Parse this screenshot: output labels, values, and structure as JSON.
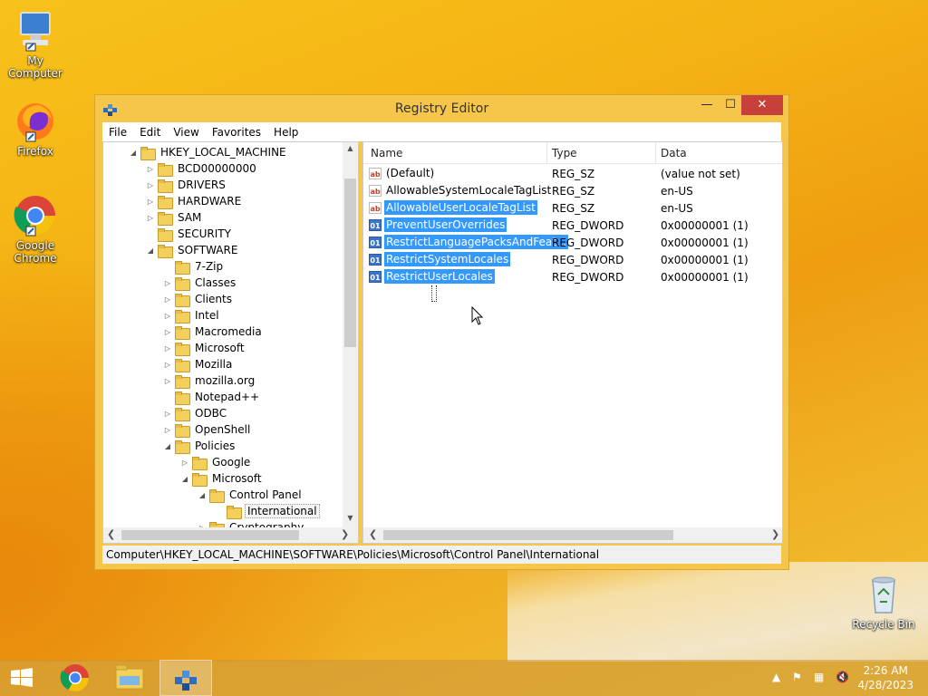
{
  "desktop": {
    "icons": [
      {
        "label": "My Computer"
      },
      {
        "label": "Firefox"
      },
      {
        "label": "Google Chrome"
      },
      {
        "label": "Recycle Bin"
      }
    ]
  },
  "window": {
    "title": "Registry Editor",
    "controls": {
      "minimize": "—",
      "maximize": "☐",
      "close": "✕"
    },
    "menu": [
      "File",
      "Edit",
      "View",
      "Favorites",
      "Help"
    ]
  },
  "tree": [
    {
      "label": "HKEY_LOCAL_MACHINE",
      "level": 0,
      "expander": "◢"
    },
    {
      "label": "BCD00000000",
      "level": 1,
      "expander": "▷"
    },
    {
      "label": "DRIVERS",
      "level": 1,
      "expander": "▷"
    },
    {
      "label": "HARDWARE",
      "level": 1,
      "expander": "▷"
    },
    {
      "label": "SAM",
      "level": 1,
      "expander": "▷"
    },
    {
      "label": "SECURITY",
      "level": 1,
      "expander": ""
    },
    {
      "label": "SOFTWARE",
      "level": 1,
      "expander": "◢"
    },
    {
      "label": "7-Zip",
      "level": 2,
      "expander": ""
    },
    {
      "label": "Classes",
      "level": 2,
      "expander": "▷"
    },
    {
      "label": "Clients",
      "level": 2,
      "expander": "▷"
    },
    {
      "label": "Intel",
      "level": 2,
      "expander": "▷"
    },
    {
      "label": "Macromedia",
      "level": 2,
      "expander": "▷"
    },
    {
      "label": "Microsoft",
      "level": 2,
      "expander": "▷"
    },
    {
      "label": "Mozilla",
      "level": 2,
      "expander": "▷"
    },
    {
      "label": "mozilla.org",
      "level": 2,
      "expander": "▷"
    },
    {
      "label": "Notepad++",
      "level": 2,
      "expander": ""
    },
    {
      "label": "ODBC",
      "level": 2,
      "expander": "▷"
    },
    {
      "label": "OpenShell",
      "level": 2,
      "expander": "▷"
    },
    {
      "label": "Policies",
      "level": 2,
      "expander": "◢"
    },
    {
      "label": "Google",
      "level": 3,
      "expander": "▷"
    },
    {
      "label": "Microsoft",
      "level": 3,
      "expander": "◢"
    },
    {
      "label": "Control Panel",
      "level": 4,
      "expander": "◢"
    },
    {
      "label": "International",
      "level": 5,
      "expander": "",
      "selected": true
    },
    {
      "label": "Cryptography",
      "level": 4,
      "expander": "▷"
    }
  ],
  "list": {
    "columns": {
      "name": "Name",
      "type": "Type",
      "data": "Data"
    },
    "rows": [
      {
        "icon": "ab",
        "name": "(Default)",
        "type": "REG_SZ",
        "data": "(value not set)",
        "highlight": false
      },
      {
        "icon": "ab",
        "name": "AllowableSystemLocaleTagList",
        "type": "REG_SZ",
        "data": "en-US",
        "highlight": false
      },
      {
        "icon": "ab",
        "name": "AllowableUserLocaleTagList",
        "type": "REG_SZ",
        "data": "en-US",
        "highlight": true
      },
      {
        "icon": "01",
        "name": "PreventUserOverrides",
        "type": "REG_DWORD",
        "data": "0x00000001 (1)",
        "highlight": true
      },
      {
        "icon": "01",
        "name": "RestrictLanguagePacksAndFeat...",
        "type": "REG_DWORD",
        "data": "0x00000001 (1)",
        "highlight": true
      },
      {
        "icon": "01",
        "name": "RestrictSystemLocales",
        "type": "REG_DWORD",
        "data": "0x00000001 (1)",
        "highlight": true
      },
      {
        "icon": "01",
        "name": "RestrictUserLocales",
        "type": "REG_DWORD",
        "data": "0x00000001 (1)",
        "highlight": true
      }
    ]
  },
  "statusbar": {
    "path": "Computer\\HKEY_LOCAL_MACHINE\\SOFTWARE\\Policies\\Microsoft\\Control Panel\\International"
  },
  "taskbar": {
    "time": "2:26 AM",
    "date": "4/28/2023"
  }
}
